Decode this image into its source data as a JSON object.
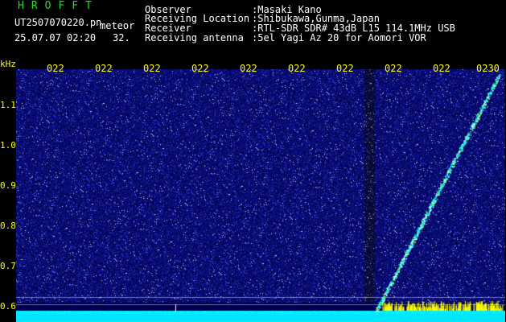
{
  "header": {
    "brand": "HROFFT",
    "filename": "UT2507070220.pn",
    "mode": "meteor",
    "datetime": "25.07.07 02:20",
    "value": "32.",
    "fields": [
      {
        "label": "Observer",
        "value": ":Masaki Kano"
      },
      {
        "label": "Receiving Location",
        "value": ":Shibukawa,Gunma,Japan"
      },
      {
        "label": "Receiver",
        "value": ":RTL-SDR SDR# 43dB L15 114.1MHz USB"
      },
      {
        "label": "Receiving antenna",
        "value": ":5el Yagi Az 20 for Aomori VOR"
      }
    ]
  },
  "axis": {
    "unit": "kHz",
    "ticks": [
      "1.1",
      "1.0",
      "0.9",
      "0.8",
      "0.7",
      "0.6"
    ]
  },
  "time_labels": [
    "022",
    "022",
    "022",
    "022",
    "022",
    "022",
    "022",
    "022",
    "022",
    "0230"
  ],
  "colors": {
    "background": "#000000",
    "noise_base": "#10107a",
    "signal": "#00ffff",
    "label": "#ffff00",
    "brand": "#22dd22"
  }
}
